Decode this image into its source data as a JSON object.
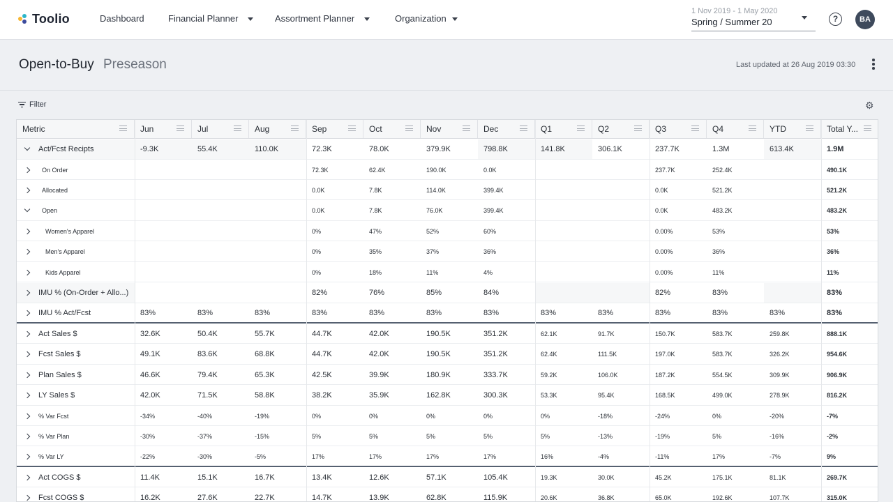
{
  "app": {
    "logo_text": "Toolio",
    "logo_colors": [
      "#f7b733",
      "#2bb5c9",
      "#3d4b9c"
    ],
    "nav": [
      {
        "label": "Dashboard",
        "has_menu": false
      },
      {
        "label": "Financial Planner",
        "has_menu": true
      },
      {
        "label": "Assortment Planner",
        "has_menu": true
      },
      {
        "label": "Organization",
        "has_menu": true
      }
    ],
    "season_range": "1 Nov 2019 - 1 May 2020",
    "season_value": "Spring / Summer 20",
    "help_glyph": "?",
    "avatar_initials": "BA"
  },
  "page": {
    "title": "Open-to-Buy",
    "subtitle": "Preseason",
    "last_updated": "Last updated at 26 Aug 2019 03:30",
    "filter_label": "Filter"
  },
  "table": {
    "columns": [
      "Metric",
      "Jun",
      "Jul",
      "Aug",
      "Sep",
      "Oct",
      "Nov",
      "Dec",
      "Q1",
      "Q2",
      "Q3",
      "Q4",
      "YTD",
      "Total Y..."
    ],
    "rows": [
      {
        "label": "Act/Fcst Recipts",
        "indent": 0,
        "chevron": "down",
        "size": "l",
        "values": [
          "-9.3K",
          "55.4K",
          "110.0K",
          "72.3K",
          "78.0K",
          "379.9K",
          "798.8K",
          "141.8K",
          "306.1K",
          "237.7K",
          "1.3M",
          "613.4K",
          "1.9M"
        ]
      },
      {
        "label": "On Order",
        "indent": 1,
        "chevron": "right",
        "size": "s",
        "values": [
          "",
          "",
          "",
          "72.3K",
          "62.4K",
          "190.0K",
          "0.0K",
          "",
          "",
          "237.7K",
          "252.4K",
          "",
          "490.1K"
        ]
      },
      {
        "label": "Allocated",
        "indent": 1,
        "chevron": "right",
        "size": "s",
        "values": [
          "",
          "",
          "",
          "0.0K",
          "7.8K",
          "114.0K",
          "399.4K",
          "",
          "",
          "0.0K",
          "521.2K",
          "",
          "521.2K"
        ]
      },
      {
        "label": "Open",
        "indent": 1,
        "chevron": "down",
        "size": "s",
        "values": [
          "",
          "",
          "",
          "0.0K",
          "7.8K",
          "76.0K",
          "399.4K",
          "",
          "",
          "0.0K",
          "483.2K",
          "",
          "483.2K"
        ]
      },
      {
        "label": "Women's Apparel",
        "indent": 2,
        "chevron": "right",
        "size": "s",
        "values": [
          "",
          "",
          "",
          "0%",
          "47%",
          "52%",
          "60%",
          "",
          "",
          "0.00%",
          "53%",
          "",
          "53%"
        ]
      },
      {
        "label": "Men's Apparel",
        "indent": 2,
        "chevron": "right",
        "size": "s",
        "values": [
          "",
          "",
          "",
          "0%",
          "35%",
          "37%",
          "36%",
          "",
          "",
          "0.00%",
          "36%",
          "",
          "36%"
        ]
      },
      {
        "label": "Kids Apparel",
        "indent": 2,
        "chevron": "right",
        "size": "s",
        "values": [
          "",
          "",
          "",
          "0%",
          "18%",
          "11%",
          "4%",
          "",
          "",
          "0.00%",
          "11%",
          "",
          "11%"
        ]
      },
      {
        "label": "IMU % (On-Order + Allo...)",
        "indent": 0,
        "chevron": "right",
        "size": "l",
        "values": [
          "",
          "",
          "",
          "82%",
          "76%",
          "85%",
          "84%",
          "",
          "",
          "82%",
          "83%",
          "",
          "83%"
        ]
      },
      {
        "label": "IMU % Act/Fcst",
        "indent": 0,
        "chevron": "right",
        "size": "l",
        "thick_bottom": true,
        "values": [
          "83%",
          "83%",
          "83%",
          "83%",
          "83%",
          "83%",
          "83%",
          "83%",
          "83%",
          "83%",
          "83%",
          "83%",
          "83%"
        ]
      },
      {
        "label": "Act Sales $",
        "indent": 0,
        "chevron": "right",
        "size": "l",
        "values": [
          "32.6K",
          "50.4K",
          "55.7K",
          "44.7K",
          "42.0K",
          "190.5K",
          "351.2K",
          "62.1K",
          "91.7K",
          "150.7K",
          "583.7K",
          "259.8K",
          "888.1K"
        ]
      },
      {
        "label": "Fcst Sales $",
        "indent": 0,
        "chevron": "right",
        "size": "l",
        "values": [
          "49.1K",
          "83.6K",
          "68.8K",
          "44.7K",
          "42.0K",
          "190.5K",
          "351.2K",
          "62.4K",
          "111.5K",
          "197.0K",
          "583.7K",
          "326.2K",
          "954.6K"
        ]
      },
      {
        "label": "Plan Sales $",
        "indent": 0,
        "chevron": "right",
        "size": "l",
        "values": [
          "46.6K",
          "79.4K",
          "65.3K",
          "42.5K",
          "39.9K",
          "180.9K",
          "333.7K",
          "59.2K",
          "106.0K",
          "187.2K",
          "554.5K",
          "309.9K",
          "906.9K"
        ]
      },
      {
        "label": "LY Sales $",
        "indent": 0,
        "chevron": "right",
        "size": "l",
        "values": [
          "42.0K",
          "71.5K",
          "58.8K",
          "38.2K",
          "35.9K",
          "162.8K",
          "300.3K",
          "53.3K",
          "95.4K",
          "168.5K",
          "499.0K",
          "278.9K",
          "816.2K"
        ]
      },
      {
        "label": "% Var Fcst",
        "indent": 0,
        "chevron": "right",
        "size": "s",
        "values": [
          "-34%",
          "-40%",
          "-19%",
          "0%",
          "0%",
          "0%",
          "0%",
          "0%",
          "-18%",
          "-24%",
          "0%",
          "-20%",
          "-7%"
        ]
      },
      {
        "label": "% Var Plan",
        "indent": 0,
        "chevron": "right",
        "size": "s",
        "values": [
          "-30%",
          "-37%",
          "-15%",
          "5%",
          "5%",
          "5%",
          "5%",
          "5%",
          "-13%",
          "-19%",
          "5%",
          "-16%",
          "-2%"
        ]
      },
      {
        "label": "% Var LY",
        "indent": 0,
        "chevron": "right",
        "size": "s",
        "thick_bottom": true,
        "values": [
          "-22%",
          "-30%",
          "-5%",
          "17%",
          "17%",
          "17%",
          "17%",
          "16%",
          "-4%",
          "-11%",
          "17%",
          "-7%",
          "9%"
        ]
      },
      {
        "label": "Act COGS $",
        "indent": 0,
        "chevron": "right",
        "size": "l",
        "values": [
          "11.4K",
          "15.1K",
          "16.7K",
          "13.4K",
          "12.6K",
          "57.1K",
          "105.4K",
          "19.3K",
          "30.0K",
          "45.2K",
          "175.1K",
          "81.1K",
          "269.7K"
        ]
      },
      {
        "label": "Fcst COGS $",
        "indent": 0,
        "chevron": "right",
        "size": "l",
        "values": [
          "16.2K",
          "27.6K",
          "22.7K",
          "14.7K",
          "13.9K",
          "62.8K",
          "115.9K",
          "20.6K",
          "36.8K",
          "65.0K",
          "192.6K",
          "107.7K",
          "315.0K"
        ]
      }
    ]
  }
}
